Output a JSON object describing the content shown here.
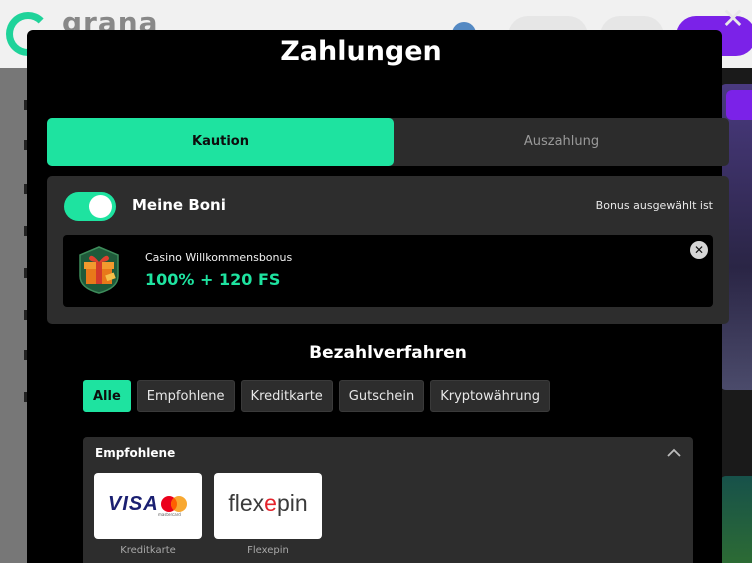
{
  "background": {
    "logo_text": "grana"
  },
  "overlay": {
    "close_glyph": "✕"
  },
  "modal": {
    "title": "Zahlungen",
    "tabs": [
      {
        "label": "Kaution",
        "active": true
      },
      {
        "label": "Auszahlung",
        "active": false
      }
    ]
  },
  "bonus": {
    "toggle_on": true,
    "label": "Meine Boni",
    "status": "Bonus ausgewählt ist",
    "card": {
      "icon": "gift-icon",
      "name": "Casino Willkommensbonus",
      "value": "100% + 120 FS",
      "remove_glyph": "✕"
    }
  },
  "methods": {
    "title": "Bezahlverfahren",
    "filters": [
      {
        "label": "Alle",
        "active": true
      },
      {
        "label": "Empfohlene",
        "active": false
      },
      {
        "label": "Kreditkarte",
        "active": false
      },
      {
        "label": "Gutschein",
        "active": false
      },
      {
        "label": "Kryptowährung",
        "active": false
      }
    ],
    "section": {
      "title": "Empfohlene",
      "expanded": true,
      "items": [
        {
          "logo_text": "VISA",
          "logo_sub": "mastercard",
          "caption": "Kreditkarte"
        },
        {
          "logo_text_a": "flex",
          "logo_text_x": "e",
          "logo_text_b": "pin",
          "caption": "Flexepin"
        }
      ]
    }
  },
  "colors": {
    "accent": "#1ee3a0",
    "modal_bg": "#000000",
    "panel_bg": "#2d2d2d",
    "brand_purple": "#7b22e8"
  }
}
